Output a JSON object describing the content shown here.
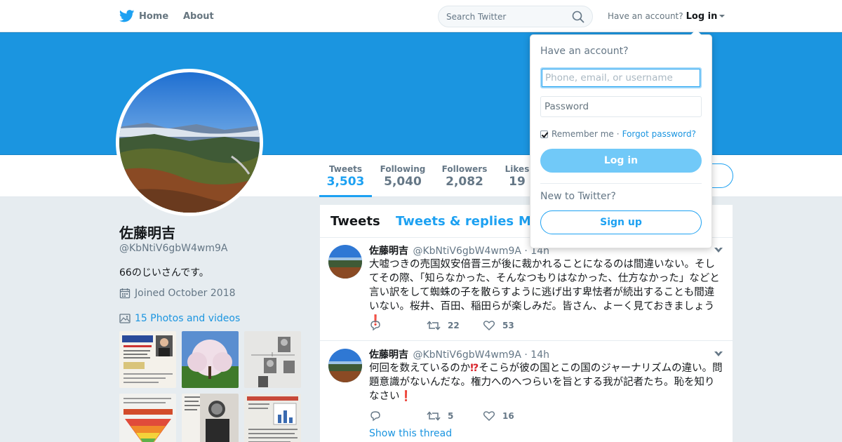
{
  "colors": {
    "brand": "#1da1f2",
    "banner": "#1b95e0",
    "link": "#1b95e0",
    "background": "#e6ecf0",
    "emoji_red": "#d8232a"
  },
  "nav": {
    "home": "Home",
    "about": "About",
    "search_placeholder": "Search Twitter",
    "have_account": "Have an account?",
    "login": "Log in"
  },
  "profile": {
    "name": "佐藤明吉",
    "handle": "@KbNtiV6gbW4wm9A",
    "bio": "66のじいさんです。",
    "joined": "Joined October 2018",
    "photos_link": "15 Photos and videos",
    "stats": [
      {
        "label": "Tweets",
        "value": "3,503"
      },
      {
        "label": "Following",
        "value": "5,040"
      },
      {
        "label": "Followers",
        "value": "2,082"
      },
      {
        "label": "Likes",
        "value": "19"
      }
    ]
  },
  "timeline": {
    "tabs": [
      "Tweets",
      "Tweets & replies",
      "M"
    ],
    "tweets": [
      {
        "name": "佐藤明吉",
        "handle": "@KbNtiV6gbW4wm9A",
        "time": "· 14h",
        "text": "大嘘つきの売国奴安倍晋三が後に裁かれることになるのは間違いない。そしてその際、「知らなかった、そんなつもりはなかった、仕方なかった」などと言い訳をして蜘蛛の子を散らすように逃げ出す卑怯者が続出することも間違いない。桜井、百田、稲田らが楽しみだ。皆さん、よーく見ておきましょう",
        "emoji": "❗",
        "retweets": "22",
        "likes": "53"
      },
      {
        "name": "佐藤明吉",
        "handle": "@KbNtiV6gbW4wm9A",
        "time": "· 14h",
        "text_a": "何回を数えているのか",
        "emoji_a": "⁉",
        "text_b": "そこらが彼の国とこの国のジャーナリズムの違い。問題意識がないんだな。権力へのへつらいを旨とする我が記者たち。恥を知りなさい",
        "emoji_b": "❗",
        "retweets": "5",
        "likes": "16",
        "show_thread": "Show this thread"
      }
    ]
  },
  "login_dropdown": {
    "title": "Have an account?",
    "username_placeholder": "Phone, email, or username",
    "password_placeholder": "Password",
    "remember": "Remember me",
    "separator": "·",
    "forgot": "Forgot password?",
    "login_button": "Log in",
    "new_to": "New to Twitter?",
    "signup_button": "Sign up"
  }
}
